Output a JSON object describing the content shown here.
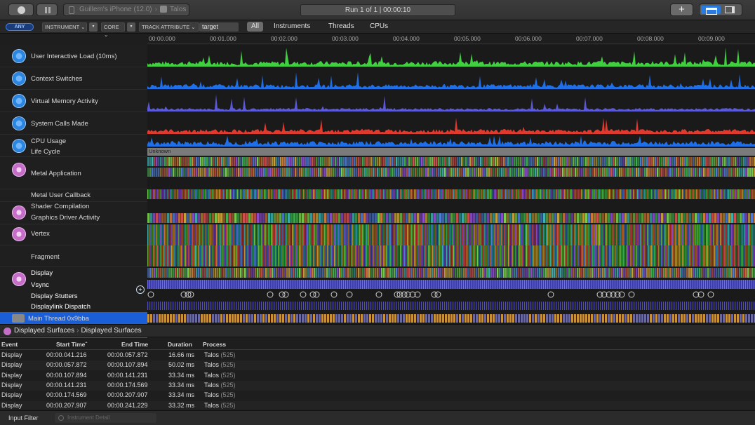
{
  "toolbar": {
    "device_name": "Guillem's iPhone (12.0)",
    "app_name": "Talos",
    "run_status": "Run 1 of 1  |  00:00:10",
    "add_label": "+"
  },
  "filterbar": {
    "any_label": "ANY",
    "instrument_label": "INSTRUMENT",
    "core_label": "CORE",
    "track_attribute_label": "TRACK ATTRIBUTE",
    "target_value": "target",
    "tabs": [
      "All",
      "Instruments",
      "Threads",
      "CPUs"
    ]
  },
  "ruler": {
    "labels": [
      "00:00.000",
      "00:01.000",
      "00:02.000",
      "00:03.000",
      "00:04.000",
      "00:05.000",
      "00:06.000",
      "00:07.000",
      "00:08.000",
      "00:09.000"
    ]
  },
  "tracks": [
    {
      "label": "User Interactive Load (10ms)",
      "icon": "gauge-icon",
      "color": "#3fcf3f"
    },
    {
      "label": "Context Switches",
      "icon": "swap-icon",
      "color": "#1f6fe8"
    },
    {
      "label": "Virtual Memory Activity",
      "icon": "memory-icon",
      "color": "#5a5ad8"
    },
    {
      "label": "System Calls Made",
      "icon": "syscall-icon",
      "color": "#e03a2e"
    },
    {
      "label": "CPU Usage",
      "icon": "cpu-icon",
      "color": "#1f6fe8"
    },
    {
      "label": "Life Cycle",
      "icon": "",
      "color": "#7a7a7a"
    },
    {
      "label": "Metal Application",
      "icon": "metal-icon",
      "color": ""
    },
    {
      "label": "Metal User Callback",
      "icon": "",
      "color": ""
    },
    {
      "label": "Shader Compilation",
      "icon": "shader-icon",
      "color": ""
    },
    {
      "label": "Graphics Driver Activity",
      "icon": "",
      "color": ""
    },
    {
      "label": "Vertex",
      "icon": "vertex-icon",
      "color": ""
    },
    {
      "label": "Fragment",
      "icon": "",
      "color": ""
    },
    {
      "label": "Display",
      "icon": "display-icon",
      "color": ""
    },
    {
      "label": "Vsync",
      "icon": "",
      "color": ""
    },
    {
      "label": "Display Stutters",
      "icon": "",
      "color": ""
    },
    {
      "label": "Displaylink Dispatch",
      "icon": "",
      "color": ""
    },
    {
      "label": "Main Thread  0x9bba",
      "icon": "thread-icon",
      "color": ""
    }
  ],
  "lifecycle_text": "Unknown",
  "detail": {
    "crumb_1": "Displayed Surfaces",
    "crumb_2": "Displayed Surfaces",
    "columns": [
      "Event",
      "Start Time",
      "End Time",
      "Duration",
      "Process"
    ],
    "rows": [
      {
        "event": "Display",
        "start": "00:00.041.216",
        "end": "00:00.057.872",
        "duration": "16.66 ms",
        "process": "Talos",
        "pid": "(525)"
      },
      {
        "event": "Display",
        "start": "00:00.057.872",
        "end": "00:00.107.894",
        "duration": "50.02 ms",
        "process": "Talos",
        "pid": "(525)"
      },
      {
        "event": "Display",
        "start": "00:00.107.894",
        "end": "00:00.141.231",
        "duration": "33.34 ms",
        "process": "Talos",
        "pid": "(525)"
      },
      {
        "event": "Display",
        "start": "00:00.141.231",
        "end": "00:00.174.569",
        "duration": "33.34 ms",
        "process": "Talos",
        "pid": "(525)"
      },
      {
        "event": "Display",
        "start": "00:00.174.569",
        "end": "00:00.207.907",
        "duration": "33.34 ms",
        "process": "Talos",
        "pid": "(525)"
      },
      {
        "event": "Display",
        "start": "00:00.207.907",
        "end": "00:00.241.229",
        "duration": "33.32 ms",
        "process": "Talos",
        "pid": "(525)"
      }
    ]
  },
  "footer": {
    "input_filter_label": "Input Filter",
    "detail_placeholder": "Instrument Detail"
  }
}
